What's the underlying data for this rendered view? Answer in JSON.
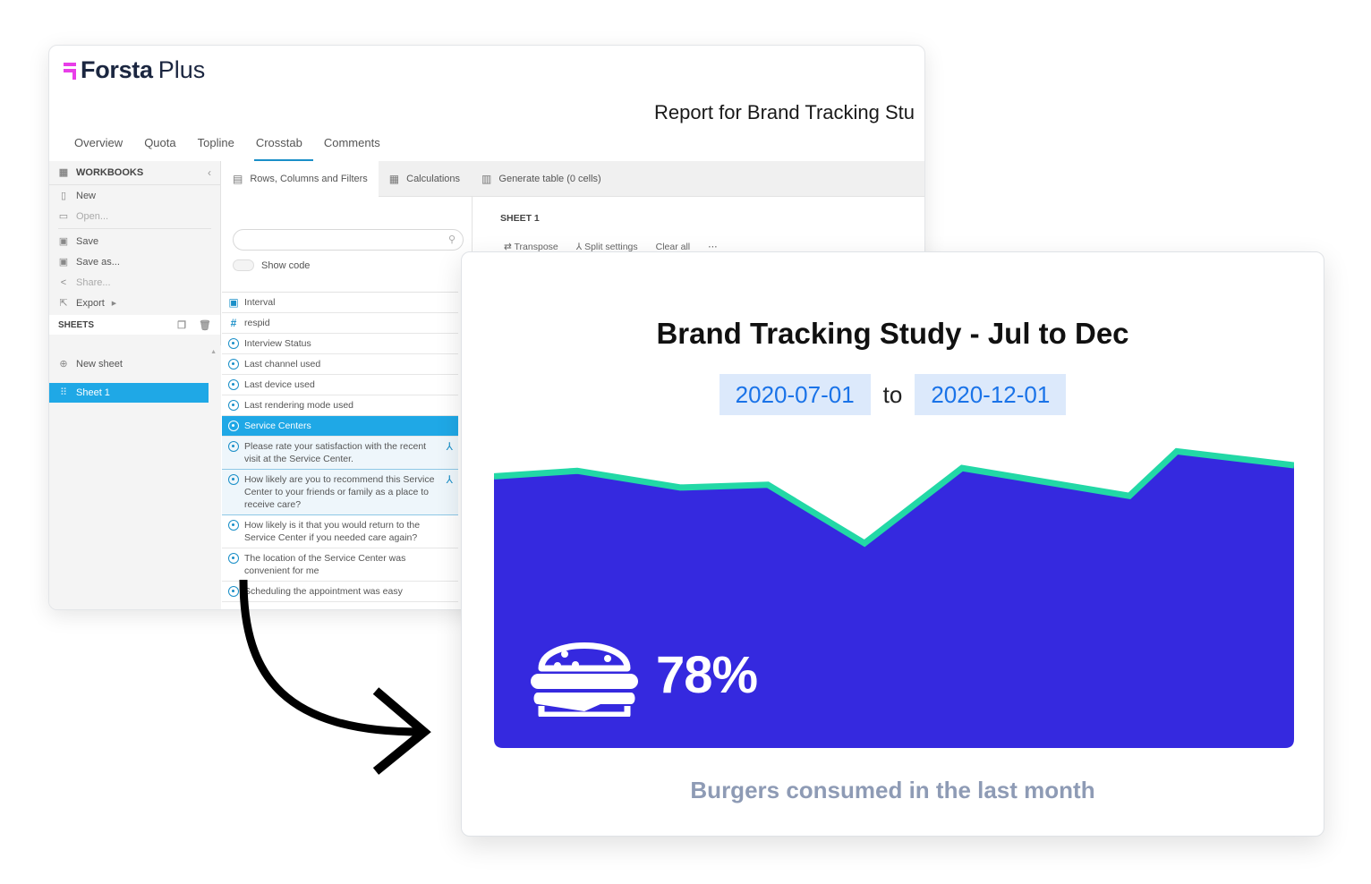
{
  "app": {
    "logo": {
      "brand": "Forsta",
      "product": "Plus",
      "accent": "#e83ee8"
    },
    "report_title": "Report for Brand Tracking Stu",
    "nav": [
      {
        "label": "Overview",
        "active": false
      },
      {
        "label": "Quota",
        "active": false
      },
      {
        "label": "Topline",
        "active": false
      },
      {
        "label": "Crosstab",
        "active": true
      },
      {
        "label": "Comments",
        "active": false
      }
    ],
    "sidebar": {
      "workbooks_label": "WORKBOOKS",
      "items": [
        {
          "label": "New",
          "icon": "file-icon",
          "enabled": true
        },
        {
          "label": "Open...",
          "icon": "folder-icon",
          "enabled": false
        },
        {
          "label": "Save",
          "icon": "save-icon",
          "enabled": true
        },
        {
          "label": "Save as...",
          "icon": "save-as-icon",
          "enabled": true
        },
        {
          "label": "Share...",
          "icon": "share-icon",
          "enabled": false
        },
        {
          "label": "Export",
          "icon": "export-icon",
          "enabled": true
        }
      ],
      "sheets_label": "SHEETS",
      "new_sheet_label": "New sheet",
      "sheets": [
        {
          "label": "Sheet 1",
          "selected": true
        }
      ]
    },
    "tabs": [
      {
        "label": "Rows, Columns and Filters",
        "active": true
      },
      {
        "label": "Calculations",
        "active": false
      },
      {
        "label": "Generate table (0 cells)",
        "active": false
      }
    ],
    "search": {
      "placeholder": "",
      "value": ""
    },
    "show_code_label": "Show code",
    "questions": [
      {
        "label": "Interval",
        "type": "date"
      },
      {
        "label": "respid",
        "type": "numeric"
      },
      {
        "label": "Interview Status",
        "type": "single"
      },
      {
        "label": "Last channel used",
        "type": "single"
      },
      {
        "label": "Last device used",
        "type": "single"
      },
      {
        "label": "Last rendering mode used",
        "type": "single"
      },
      {
        "label": "Service Centers",
        "type": "single",
        "selected": true
      },
      {
        "label": "Please rate your satisfaction with the recent visit at the Service Center.",
        "type": "single",
        "split": true
      },
      {
        "label": "How likely are you to recommend this Service Center to your friends or family as a place to receive care?",
        "type": "single",
        "split": true
      },
      {
        "label": "How likely is it that you would return to the Service Center if you needed care again?",
        "type": "single"
      },
      {
        "label": "The location of the Service Center was convenient for me",
        "type": "single"
      },
      {
        "label": "Scheduling the appointment was easy",
        "type": "single"
      }
    ],
    "sheet_title": "SHEET 1",
    "actions": [
      {
        "label": "Transpose",
        "icon": "transpose-icon"
      },
      {
        "label": "Split settings",
        "icon": "split-icon"
      },
      {
        "label": "Clear all",
        "icon": ""
      },
      {
        "label": "⋯",
        "icon": "more-icon"
      }
    ]
  },
  "card": {
    "title": "Brand Tracking Study - Jul to Dec",
    "date_from": "2020-07-01",
    "date_to_label": "to",
    "date_to": "2020-12-01",
    "stat_value": "78%",
    "stat_icon": "burger-icon",
    "caption": "Burgers consumed in the last month",
    "colors": {
      "area": "#3529df",
      "line": "#22d8a6",
      "date_bg": "#dce9fb",
      "date_text": "#1a73e8",
      "caption": "#8e9bb5"
    }
  },
  "chart_data": {
    "type": "area",
    "title": "",
    "x": [
      1,
      2,
      3,
      4,
      5,
      6,
      7,
      8,
      9
    ],
    "values": [
      82,
      84,
      78,
      79,
      58,
      85,
      75,
      91,
      86
    ],
    "ylim": [
      0,
      100
    ],
    "xlabel": "",
    "ylabel": "",
    "grid": false,
    "legend": "none"
  }
}
